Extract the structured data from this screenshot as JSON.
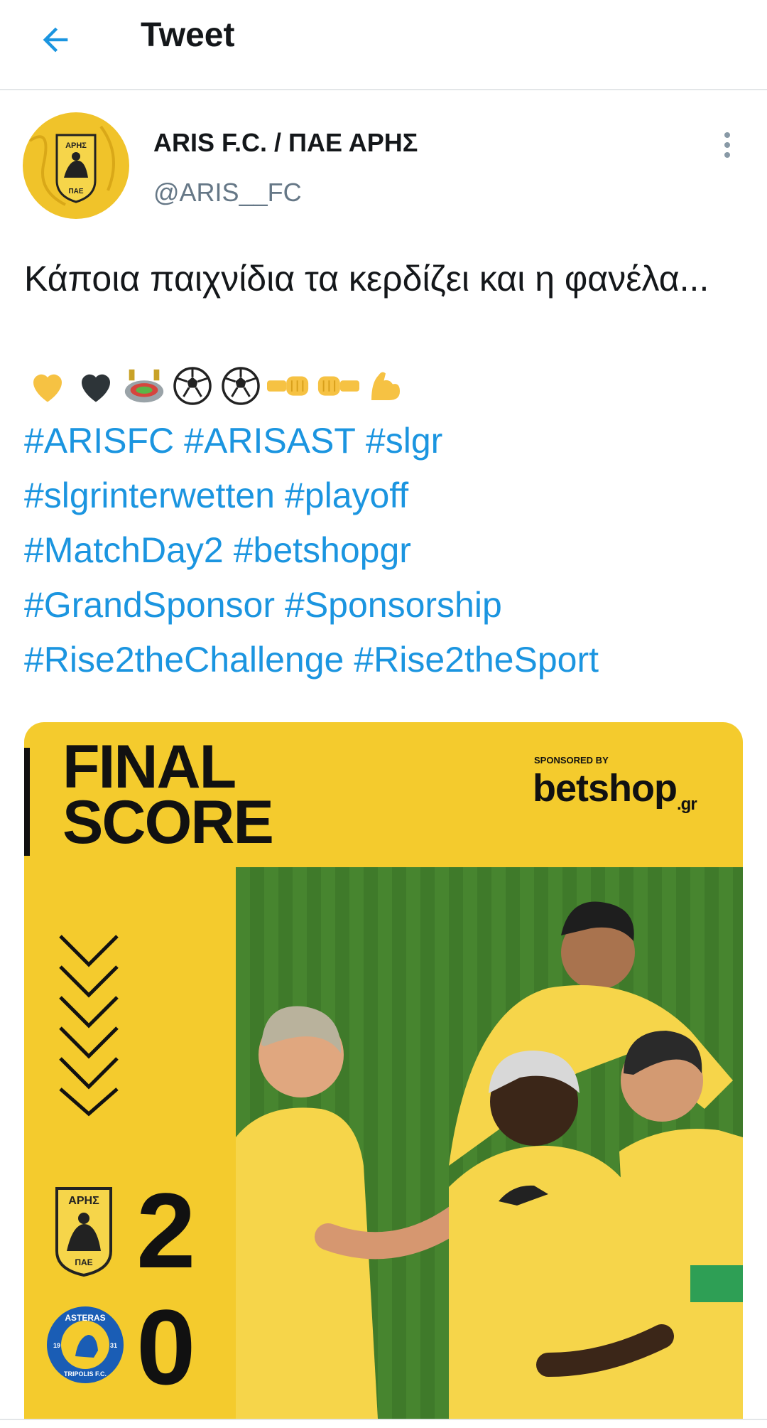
{
  "header": {
    "title": "Tweet"
  },
  "tweet": {
    "author_name": "ARIS F.C. / ΠΑΕ ΑΡΗΣ",
    "handle": "@ARIS__FC",
    "text": "Κάποια παιχνίδια τα κερδίζει και η φανέλα...",
    "emojis": [
      "yellow-heart",
      "black-heart",
      "stadium",
      "soccer-ball",
      "soccer-ball",
      "left-facing-fist",
      "right-facing-fist",
      "flexed-biceps"
    ],
    "hashtags": [
      "#ARISFC",
      "#ARISAST",
      "#slgr",
      "#slgrinterwetten",
      "#playoff",
      "#MatchDay2",
      "#betshopgr",
      "#GrandSponsor",
      "#Sponsorship",
      "#Rise2theChallenge",
      "#Rise2theSport"
    ]
  },
  "card": {
    "title_line1": "FINAL",
    "title_line2": "SCORE",
    "sponsored_by": "SPONSORED BY",
    "sponsor_name": "betshop",
    "sponsor_suffix": ".gr",
    "home_crest_text": "ΑΡΗΣ",
    "home_crest_bottom": "ΠΑΕ",
    "home_score": "2",
    "away_crest_text": "ASTERAS",
    "away_crest_bottom": "TRIPOLIS F.C.",
    "away_year_left": "19",
    "away_year_right": "31",
    "away_score": "0"
  },
  "colors": {
    "accent": "#1b95e0",
    "card_yellow": "#f4cb2d",
    "text": "#14171a",
    "muted": "#657786"
  }
}
